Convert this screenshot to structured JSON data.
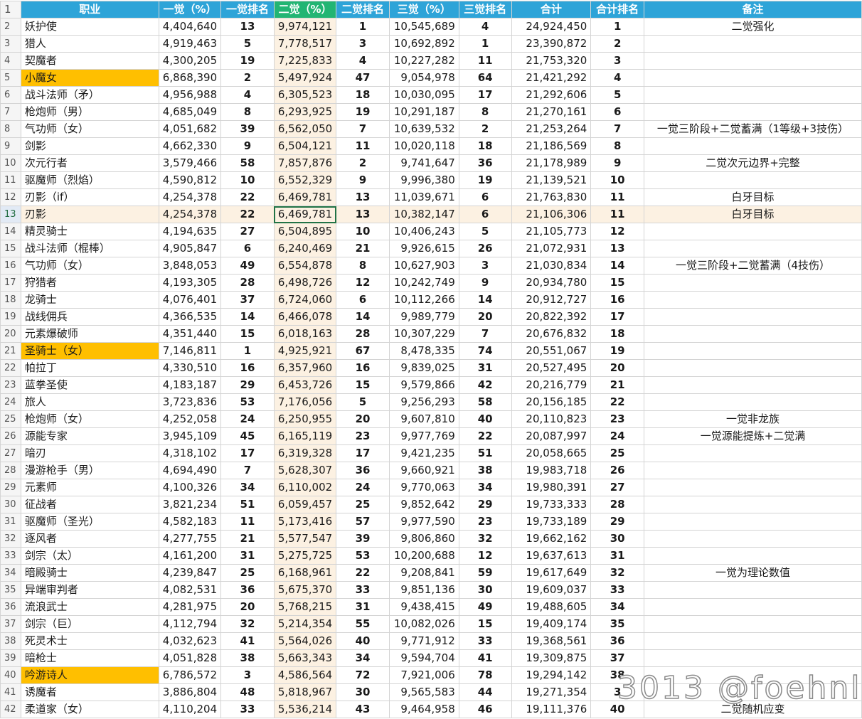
{
  "header": [
    "职业",
    "一觉（%）",
    "一觉排名",
    "二觉（%）",
    "二觉排名",
    "三觉（%）",
    "三觉排名",
    "合计",
    "合计排名",
    "备注"
  ],
  "rows": [
    {
      "n": 2,
      "job": "妖护使",
      "a1": "4,404,640",
      "r1": "13",
      "a2": "9,974,121",
      "r2": "1",
      "a3": "10,545,689",
      "r3": "4",
      "sum": "24,924,450",
      "rs": "1",
      "note": "二觉强化"
    },
    {
      "n": 3,
      "job": "猎人",
      "a1": "4,919,463",
      "r1": "5",
      "a2": "7,778,517",
      "r2": "3",
      "a3": "10,692,892",
      "r3": "1",
      "sum": "23,390,872",
      "rs": "2",
      "note": ""
    },
    {
      "n": 4,
      "job": "契魔者",
      "a1": "4,300,205",
      "r1": "19",
      "a2": "7,225,833",
      "r2": "4",
      "a3": "10,227,282",
      "r3": "11",
      "sum": "21,753,320",
      "rs": "3",
      "note": ""
    },
    {
      "n": 5,
      "job": "小魔女",
      "a1": "6,868,390",
      "r1": "2",
      "a2": "5,497,924",
      "r2": "47",
      "a3": "9,054,978",
      "r3": "64",
      "sum": "21,421,292",
      "rs": "4",
      "note": "",
      "hl": true
    },
    {
      "n": 6,
      "job": "战斗法师（矛）",
      "a1": "4,956,988",
      "r1": "4",
      "a2": "6,305,523",
      "r2": "18",
      "a3": "10,030,095",
      "r3": "17",
      "sum": "21,292,606",
      "rs": "5",
      "note": ""
    },
    {
      "n": 7,
      "job": "枪炮师（男）",
      "a1": "4,685,049",
      "r1": "8",
      "a2": "6,293,925",
      "r2": "19",
      "a3": "10,291,187",
      "r3": "8",
      "sum": "21,270,161",
      "rs": "6",
      "note": ""
    },
    {
      "n": 8,
      "job": "气功师（女）",
      "a1": "4,051,682",
      "r1": "39",
      "a2": "6,562,050",
      "r2": "7",
      "a3": "10,639,532",
      "r3": "2",
      "sum": "21,253,264",
      "rs": "7",
      "note": "一觉三阶段+二觉蓄满（1等级+3技伤）"
    },
    {
      "n": 9,
      "job": "剑影",
      "a1": "4,662,330",
      "r1": "9",
      "a2": "6,504,121",
      "r2": "11",
      "a3": "10,020,118",
      "r3": "18",
      "sum": "21,186,569",
      "rs": "8",
      "note": ""
    },
    {
      "n": 10,
      "job": "次元行者",
      "a1": "3,579,466",
      "r1": "58",
      "a2": "7,857,876",
      "r2": "2",
      "a3": "9,741,647",
      "r3": "36",
      "sum": "21,178,989",
      "rs": "9",
      "note": "二觉次元边界+完整"
    },
    {
      "n": 11,
      "job": "驱魔师（烈焰）",
      "a1": "4,590,812",
      "r1": "10",
      "a2": "6,552,329",
      "r2": "9",
      "a3": "9,996,380",
      "r3": "19",
      "sum": "21,139,521",
      "rs": "10",
      "note": ""
    },
    {
      "n": 12,
      "job": "刃影（if）",
      "a1": "4,254,378",
      "r1": "22",
      "a2": "6,469,781",
      "r2": "13",
      "a3": "11,039,671",
      "r3": "6",
      "sum": "21,763,830",
      "rs": "11",
      "note": "白牙目标"
    },
    {
      "n": 13,
      "job": "刃影",
      "a1": "4,254,378",
      "r1": "22",
      "a2": "6,469,781",
      "r2": "13",
      "a3": "10,382,147",
      "r3": "6",
      "sum": "21,106,306",
      "rs": "11",
      "note": "白牙目标",
      "sel": true
    },
    {
      "n": 14,
      "job": "精灵骑士",
      "a1": "4,194,635",
      "r1": "27",
      "a2": "6,504,895",
      "r2": "10",
      "a3": "10,406,243",
      "r3": "5",
      "sum": "21,105,773",
      "rs": "12",
      "note": ""
    },
    {
      "n": 15,
      "job": "战斗法师（棍棒）",
      "a1": "4,905,847",
      "r1": "6",
      "a2": "6,240,469",
      "r2": "21",
      "a3": "9,926,615",
      "r3": "26",
      "sum": "21,072,931",
      "rs": "13",
      "note": ""
    },
    {
      "n": 16,
      "job": "气功师（女）",
      "a1": "3,848,053",
      "r1": "49",
      "a2": "6,554,878",
      "r2": "8",
      "a3": "10,627,903",
      "r3": "3",
      "sum": "21,030,834",
      "rs": "14",
      "note": "一觉三阶段+二觉蓄满（4技伤）"
    },
    {
      "n": 17,
      "job": "狩猎者",
      "a1": "4,193,305",
      "r1": "28",
      "a2": "6,498,726",
      "r2": "12",
      "a3": "10,242,749",
      "r3": "9",
      "sum": "20,934,780",
      "rs": "15",
      "note": ""
    },
    {
      "n": 18,
      "job": "龙骑士",
      "a1": "4,076,401",
      "r1": "37",
      "a2": "6,724,060",
      "r2": "6",
      "a3": "10,112,266",
      "r3": "14",
      "sum": "20,912,727",
      "rs": "16",
      "note": ""
    },
    {
      "n": 19,
      "job": "战线佣兵",
      "a1": "4,366,535",
      "r1": "14",
      "a2": "6,466,078",
      "r2": "14",
      "a3": "9,989,779",
      "r3": "20",
      "sum": "20,822,392",
      "rs": "17",
      "note": ""
    },
    {
      "n": 20,
      "job": "元素爆破师",
      "a1": "4,351,440",
      "r1": "15",
      "a2": "6,018,163",
      "r2": "28",
      "a3": "10,307,229",
      "r3": "7",
      "sum": "20,676,832",
      "rs": "18",
      "note": ""
    },
    {
      "n": 21,
      "job": "圣骑士（女）",
      "a1": "7,146,811",
      "r1": "1",
      "a2": "4,925,921",
      "r2": "67",
      "a3": "8,478,335",
      "r3": "74",
      "sum": "20,551,067",
      "rs": "19",
      "note": "",
      "hl": true
    },
    {
      "n": 22,
      "job": "帕拉丁",
      "a1": "4,330,510",
      "r1": "16",
      "a2": "6,357,960",
      "r2": "16",
      "a3": "9,839,025",
      "r3": "31",
      "sum": "20,527,495",
      "rs": "20",
      "note": ""
    },
    {
      "n": 23,
      "job": "蓝拳圣使",
      "a1": "4,183,187",
      "r1": "29",
      "a2": "6,453,726",
      "r2": "15",
      "a3": "9,579,866",
      "r3": "42",
      "sum": "20,216,779",
      "rs": "21",
      "note": ""
    },
    {
      "n": 24,
      "job": "旅人",
      "a1": "3,723,836",
      "r1": "53",
      "a2": "7,176,056",
      "r2": "5",
      "a3": "9,256,293",
      "r3": "58",
      "sum": "20,156,185",
      "rs": "22",
      "note": ""
    },
    {
      "n": 25,
      "job": "枪炮师（女）",
      "a1": "4,252,058",
      "r1": "24",
      "a2": "6,250,955",
      "r2": "20",
      "a3": "9,607,810",
      "r3": "40",
      "sum": "20,110,823",
      "rs": "23",
      "note": "一觉非龙族"
    },
    {
      "n": 26,
      "job": "源能专家",
      "a1": "3,945,109",
      "r1": "45",
      "a2": "6,165,119",
      "r2": "23",
      "a3": "9,977,769",
      "r3": "22",
      "sum": "20,087,997",
      "rs": "24",
      "note": "一觉源能提炼+二觉满"
    },
    {
      "n": 27,
      "job": "暗刃",
      "a1": "4,318,102",
      "r1": "17",
      "a2": "6,319,328",
      "r2": "17",
      "a3": "9,421,235",
      "r3": "51",
      "sum": "20,058,665",
      "rs": "25",
      "note": ""
    },
    {
      "n": 28,
      "job": "漫游枪手（男）",
      "a1": "4,694,490",
      "r1": "7",
      "a2": "5,628,307",
      "r2": "36",
      "a3": "9,660,921",
      "r3": "38",
      "sum": "19,983,718",
      "rs": "26",
      "note": ""
    },
    {
      "n": 29,
      "job": "元素师",
      "a1": "4,100,326",
      "r1": "34",
      "a2": "6,110,002",
      "r2": "24",
      "a3": "9,770,063",
      "r3": "34",
      "sum": "19,980,391",
      "rs": "27",
      "note": ""
    },
    {
      "n": 30,
      "job": "征战者",
      "a1": "3,821,234",
      "r1": "51",
      "a2": "6,059,457",
      "r2": "25",
      "a3": "9,852,642",
      "r3": "29",
      "sum": "19,733,333",
      "rs": "28",
      "note": ""
    },
    {
      "n": 31,
      "job": "驱魔师（圣光）",
      "a1": "4,582,183",
      "r1": "11",
      "a2": "5,173,416",
      "r2": "57",
      "a3": "9,977,590",
      "r3": "23",
      "sum": "19,733,189",
      "rs": "29",
      "note": ""
    },
    {
      "n": 32,
      "job": "逐风者",
      "a1": "4,277,755",
      "r1": "21",
      "a2": "5,577,547",
      "r2": "39",
      "a3": "9,806,860",
      "r3": "32",
      "sum": "19,662,162",
      "rs": "30",
      "note": ""
    },
    {
      "n": 33,
      "job": "剑宗（太）",
      "a1": "4,161,200",
      "r1": "31",
      "a2": "5,275,725",
      "r2": "53",
      "a3": "10,200,688",
      "r3": "12",
      "sum": "19,637,613",
      "rs": "31",
      "note": ""
    },
    {
      "n": 34,
      "job": "暗殿骑士",
      "a1": "4,239,847",
      "r1": "25",
      "a2": "6,168,961",
      "r2": "22",
      "a3": "9,208,841",
      "r3": "59",
      "sum": "19,617,649",
      "rs": "32",
      "note": "一觉为理论数值"
    },
    {
      "n": 35,
      "job": "异端审判者",
      "a1": "4,082,531",
      "r1": "36",
      "a2": "5,675,370",
      "r2": "33",
      "a3": "9,851,136",
      "r3": "30",
      "sum": "19,609,037",
      "rs": "33",
      "note": ""
    },
    {
      "n": 36,
      "job": "流浪武士",
      "a1": "4,281,975",
      "r1": "20",
      "a2": "5,768,215",
      "r2": "31",
      "a3": "9,438,415",
      "r3": "49",
      "sum": "19,488,605",
      "rs": "34",
      "note": ""
    },
    {
      "n": 37,
      "job": "剑宗（巨）",
      "a1": "4,112,794",
      "r1": "32",
      "a2": "5,214,354",
      "r2": "55",
      "a3": "10,082,026",
      "r3": "15",
      "sum": "19,409,174",
      "rs": "35",
      "note": ""
    },
    {
      "n": 38,
      "job": "死灵术士",
      "a1": "4,032,623",
      "r1": "41",
      "a2": "5,564,026",
      "r2": "40",
      "a3": "9,771,912",
      "r3": "33",
      "sum": "19,368,561",
      "rs": "36",
      "note": ""
    },
    {
      "n": 39,
      "job": "暗枪士",
      "a1": "4,051,828",
      "r1": "38",
      "a2": "5,663,343",
      "r2": "34",
      "a3": "9,594,704",
      "r3": "41",
      "sum": "19,309,875",
      "rs": "37",
      "note": ""
    },
    {
      "n": 40,
      "job": "吟游诗人",
      "a1": "6,786,572",
      "r1": "3",
      "a2": "4,586,564",
      "r2": "72",
      "a3": "7,921,006",
      "r3": "78",
      "sum": "19,294,142",
      "rs": "38",
      "note": "",
      "hl": true
    },
    {
      "n": 41,
      "job": "诱魔者",
      "a1": "3,886,804",
      "r1": "48",
      "a2": "5,818,967",
      "r2": "30",
      "a3": "9,565,583",
      "r3": "44",
      "sum": "19,271,354",
      "rs": "3",
      "note": ""
    },
    {
      "n": 42,
      "job": "柔道家（女）",
      "a1": "4,110,204",
      "r1": "33",
      "a2": "5,536,214",
      "r2": "43",
      "a3": "9,464,958",
      "r3": "46",
      "sum": "19,111,376",
      "rs": "40",
      "note": "二觉随机应变"
    }
  ],
  "watermark": "3013 @foehnl",
  "colors": {
    "header": "#2ea4d8",
    "header_selected": "#22b573",
    "highlight": "#ffbf00",
    "selected_fill": "#fcf1e2",
    "active_border": "#217346"
  }
}
